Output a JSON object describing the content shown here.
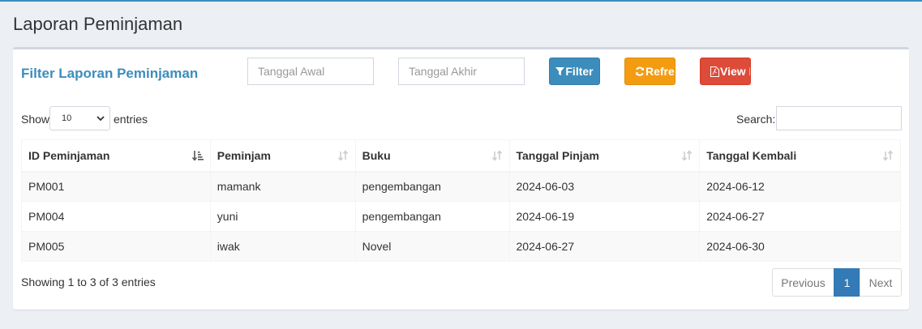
{
  "page": {
    "title": "Laporan Peminjaman"
  },
  "filter": {
    "title": "Filter Laporan Peminjaman",
    "start_placeholder": "Tanggal Awal",
    "end_placeholder": "Tanggal Akhir",
    "filter_label": "Filter",
    "refresh_label": "Refresh",
    "view_label": "View PDF"
  },
  "table_controls": {
    "show_label": "Show",
    "entries_value": "10",
    "entries_label": "entries",
    "search_label": "Search:"
  },
  "table": {
    "headers": [
      "ID Peminjaman",
      "Peminjam",
      "Buku",
      "Tanggal Pinjam",
      "Tanggal Kembali"
    ],
    "rows": [
      [
        "PM001",
        "mamank",
        "pengembangan",
        "2024-06-03",
        "2024-06-12"
      ],
      [
        "PM004",
        "yuni",
        "pengembangan",
        "2024-06-19",
        "2024-06-27"
      ],
      [
        "PM005",
        "iwak",
        "Novel",
        "2024-06-27",
        "2024-06-30"
      ]
    ]
  },
  "footer": {
    "info": "Showing 1 to 3 of 3 entries",
    "previous": "Previous",
    "current_page": "1",
    "next": "Next"
  },
  "colors": {
    "accent": "#3c8dbc",
    "filter_button": "#3c8dbc",
    "refresh_button": "#f39c12",
    "view_button": "#dd4b39",
    "active_page": "#337ab7"
  },
  "icons": {
    "filter": "filter-icon",
    "refresh": "refresh-icon",
    "view": "pdf-file-icon",
    "sort_active": "sort-amount-asc-icon",
    "sort": "sort-icon",
    "select": "chevron-down-icon"
  }
}
